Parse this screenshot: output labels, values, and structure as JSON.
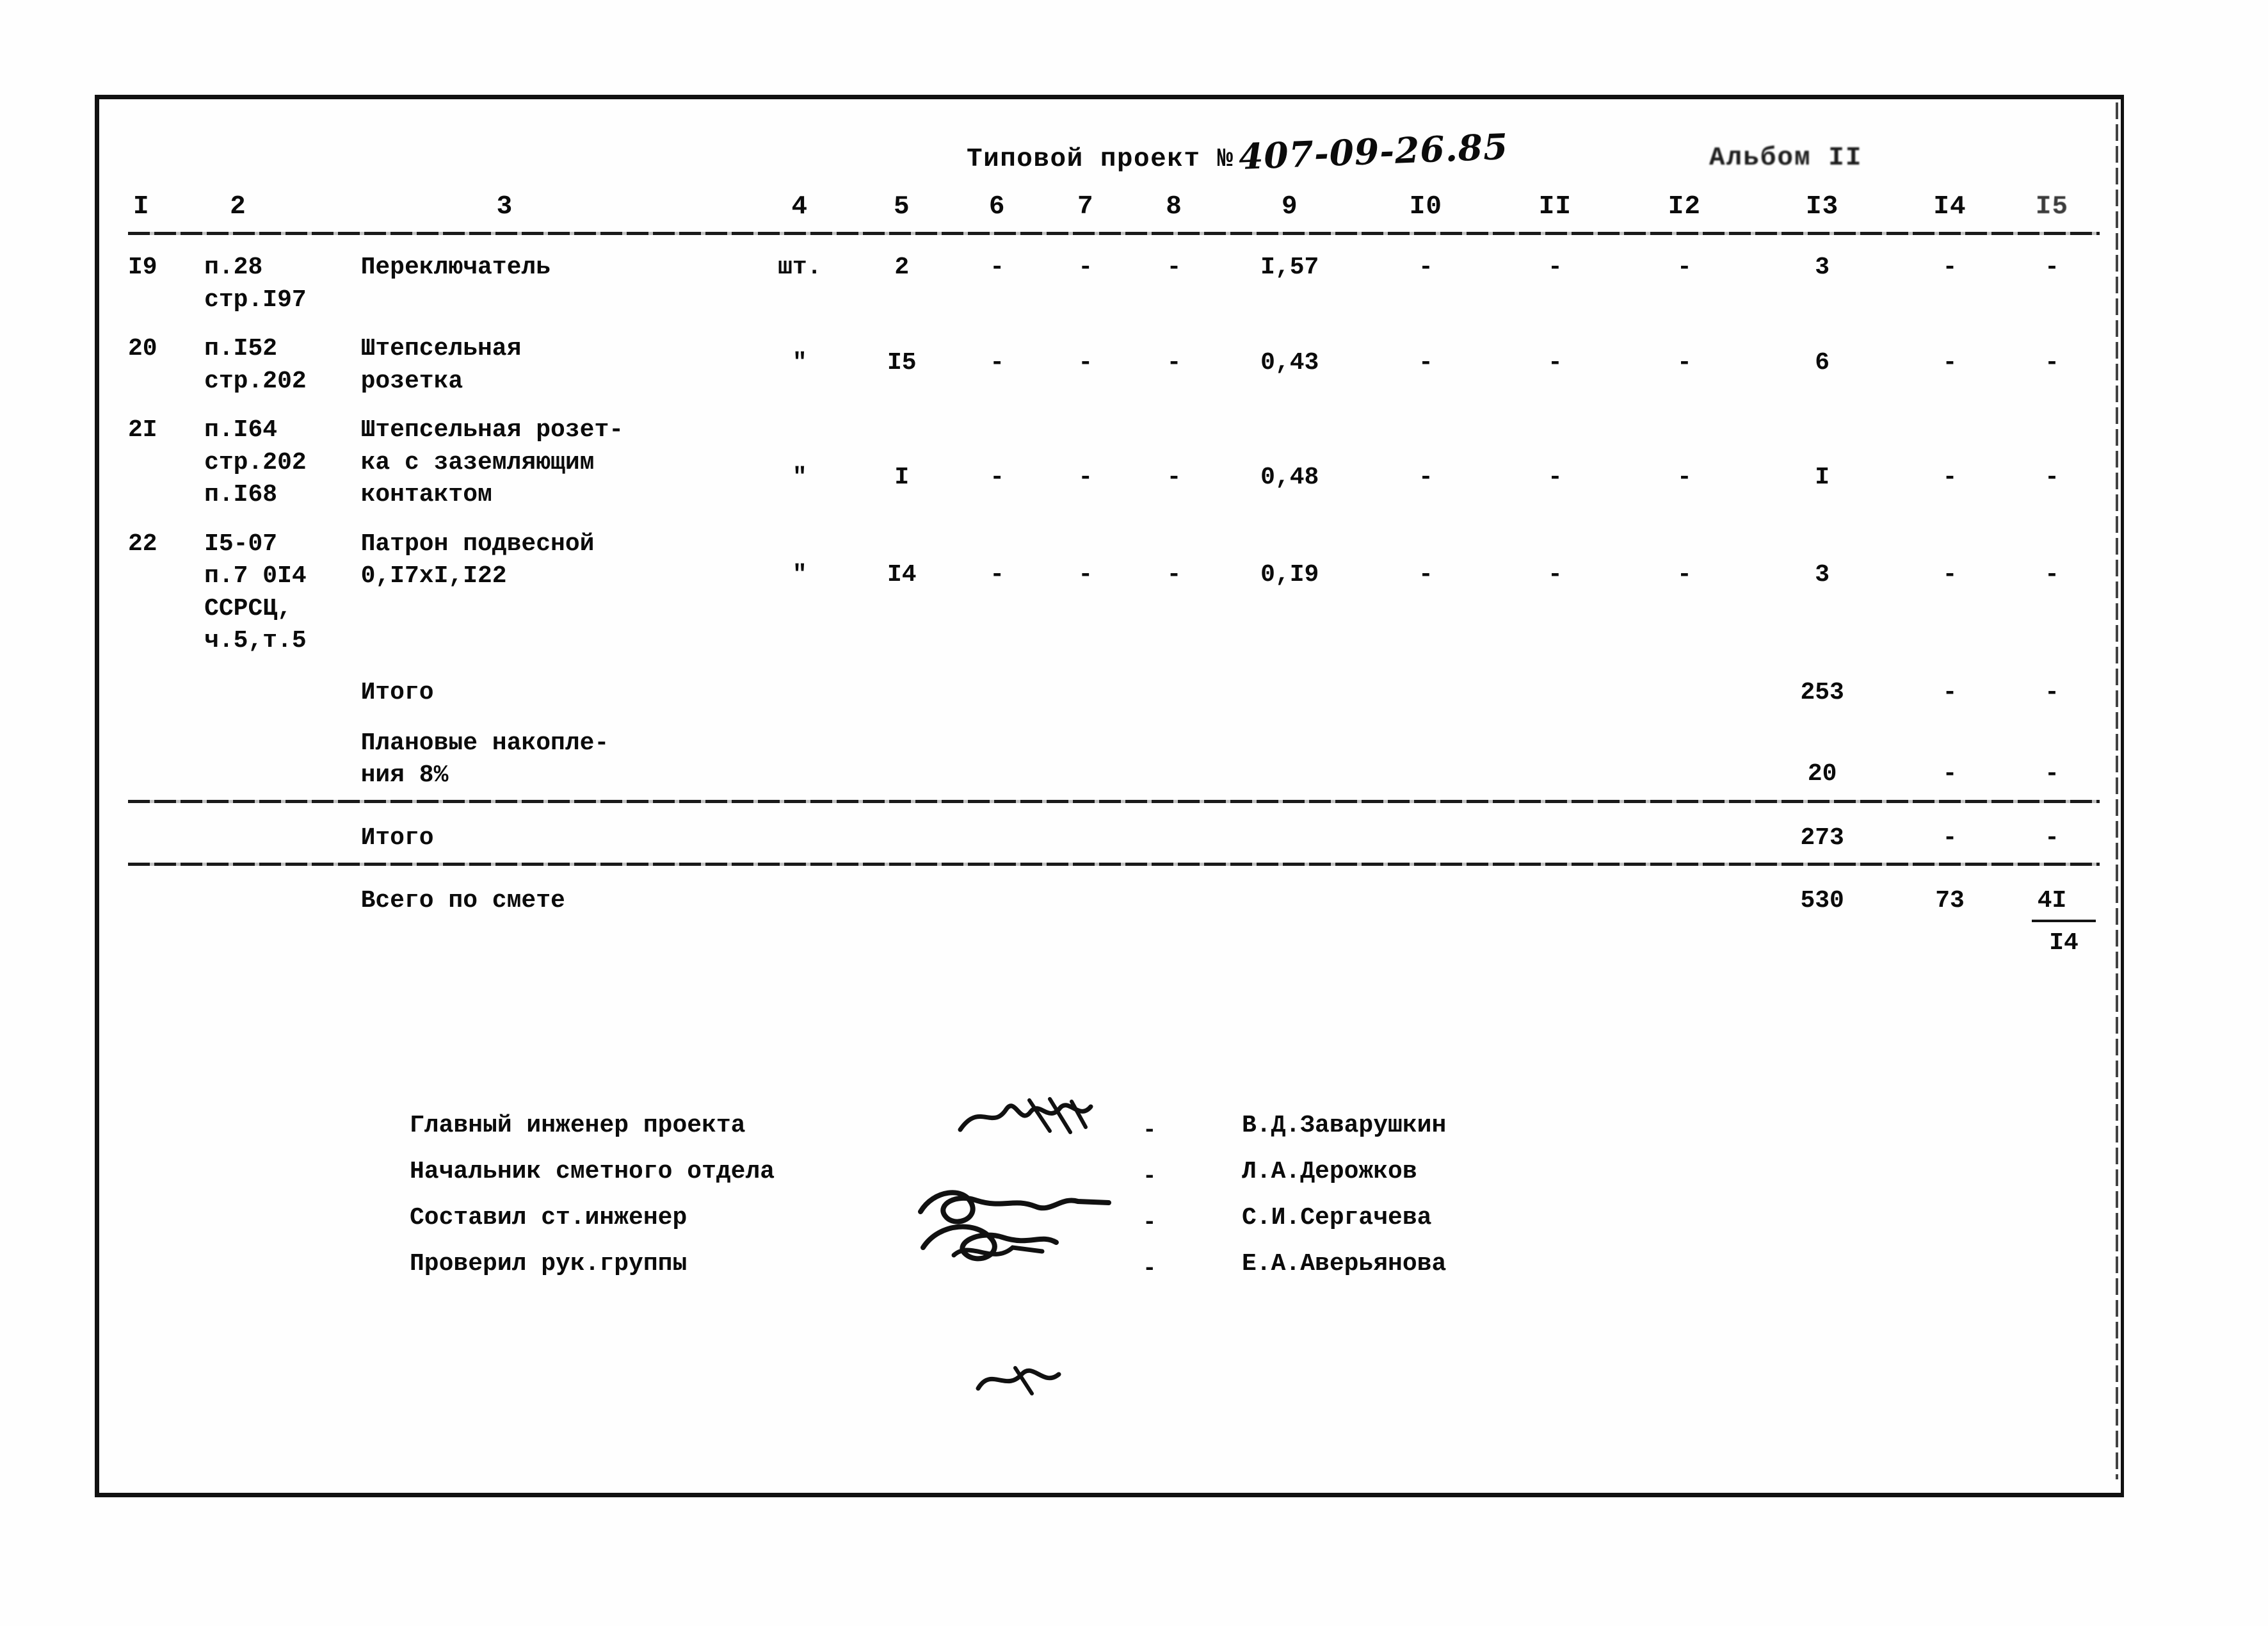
{
  "header": {
    "label": "Типовой проект №",
    "number": "407-09-26.85",
    "album": "Альбом II"
  },
  "table": {
    "column_numbers": [
      "I",
      "2",
      "3",
      "4",
      "5",
      "6",
      "7",
      "8",
      "9",
      "I0",
      "II",
      "I2",
      "I3",
      "I4",
      "I5"
    ],
    "dash": "-",
    "ditto": "\"",
    "rows": [
      {
        "num": "I9",
        "justification_1": "п.28",
        "justification_2": "стр.I97",
        "justification_3": "",
        "justification_4": "",
        "name_1": "Переключатель",
        "name_2": "",
        "name_3": "",
        "unit": "шт.",
        "qty": "2",
        "c6": "-",
        "c7": "-",
        "c8": "-",
        "c9": "I,57",
        "c10": "-",
        "c11": "-",
        "c12": "-",
        "c13": "3",
        "c14": "-",
        "c15": "-"
      },
      {
        "num": "20",
        "justification_1": "п.I52",
        "justification_2": "стр.202",
        "justification_3": "",
        "justification_4": "",
        "name_1": "Штепсельная",
        "name_2": "розетка",
        "name_3": "",
        "unit": "\"",
        "qty": "I5",
        "c6": "-",
        "c7": "-",
        "c8": "-",
        "c9": "0,43",
        "c10": "-",
        "c11": "-",
        "c12": "-",
        "c13": "6",
        "c14": "-",
        "c15": "-"
      },
      {
        "num": "2I",
        "justification_1": "п.I64",
        "justification_2": "стр.202",
        "justification_3": "п.I68",
        "justification_4": "",
        "name_1": "Штепсельная розет-",
        "name_2": "ка с заземляющим",
        "name_3": "контактом",
        "unit": "\"",
        "qty": "I",
        "c6": "-",
        "c7": "-",
        "c8": "-",
        "c9": "0,48",
        "c10": "-",
        "c11": "-",
        "c12": "-",
        "c13": "I",
        "c14": "-",
        "c15": "-"
      },
      {
        "num": "22",
        "justification_1": "I5-07",
        "justification_2": "п.7 0I4",
        "justification_3": "ССРСЦ,",
        "justification_4": "ч.5,т.5",
        "name_1": "Патрон подвесной",
        "name_2": "0,I7xI,I22",
        "name_3": "",
        "unit": "\"",
        "qty": "I4",
        "c6": "-",
        "c7": "-",
        "c8": "-",
        "c9": "0,I9",
        "c10": "-",
        "c11": "-",
        "c12": "-",
        "c13": "3",
        "c14": "-",
        "c15": "-"
      }
    ],
    "summary": [
      {
        "label_1": "Итого",
        "label_2": "",
        "c13": "253",
        "c14": "-",
        "c15": "-",
        "c15_extra": ""
      },
      {
        "label_1": "Плановые накопле-",
        "label_2": "ния 8%",
        "c13": "20",
        "c14": "-",
        "c15": "-",
        "c15_extra": ""
      },
      {
        "label_1": "Итого",
        "label_2": "",
        "c13": "273",
        "c14": "-",
        "c15": "-",
        "c15_extra": ""
      },
      {
        "label_1": "Всего по смете",
        "label_2": "",
        "c13": "530",
        "c14": "73",
        "c15": "4I",
        "c15_extra": "I4"
      }
    ]
  },
  "signatures": [
    {
      "title": "Главный инженер проекта",
      "mark": "-",
      "name": "В.Д.Заварушкин"
    },
    {
      "title": "Начальник сметного отдела",
      "mark": "-",
      "name": "Л.А.Дерожков"
    },
    {
      "title": "Составил ст.инженер",
      "mark": "-",
      "name": "С.И.Сергачева"
    },
    {
      "title": "Проверил рук.группы",
      "mark": "-",
      "name": "Е.А.Аверьянова"
    }
  ],
  "margin_artifacts": {
    "top": "",
    "mid": "",
    "bottom": ""
  }
}
